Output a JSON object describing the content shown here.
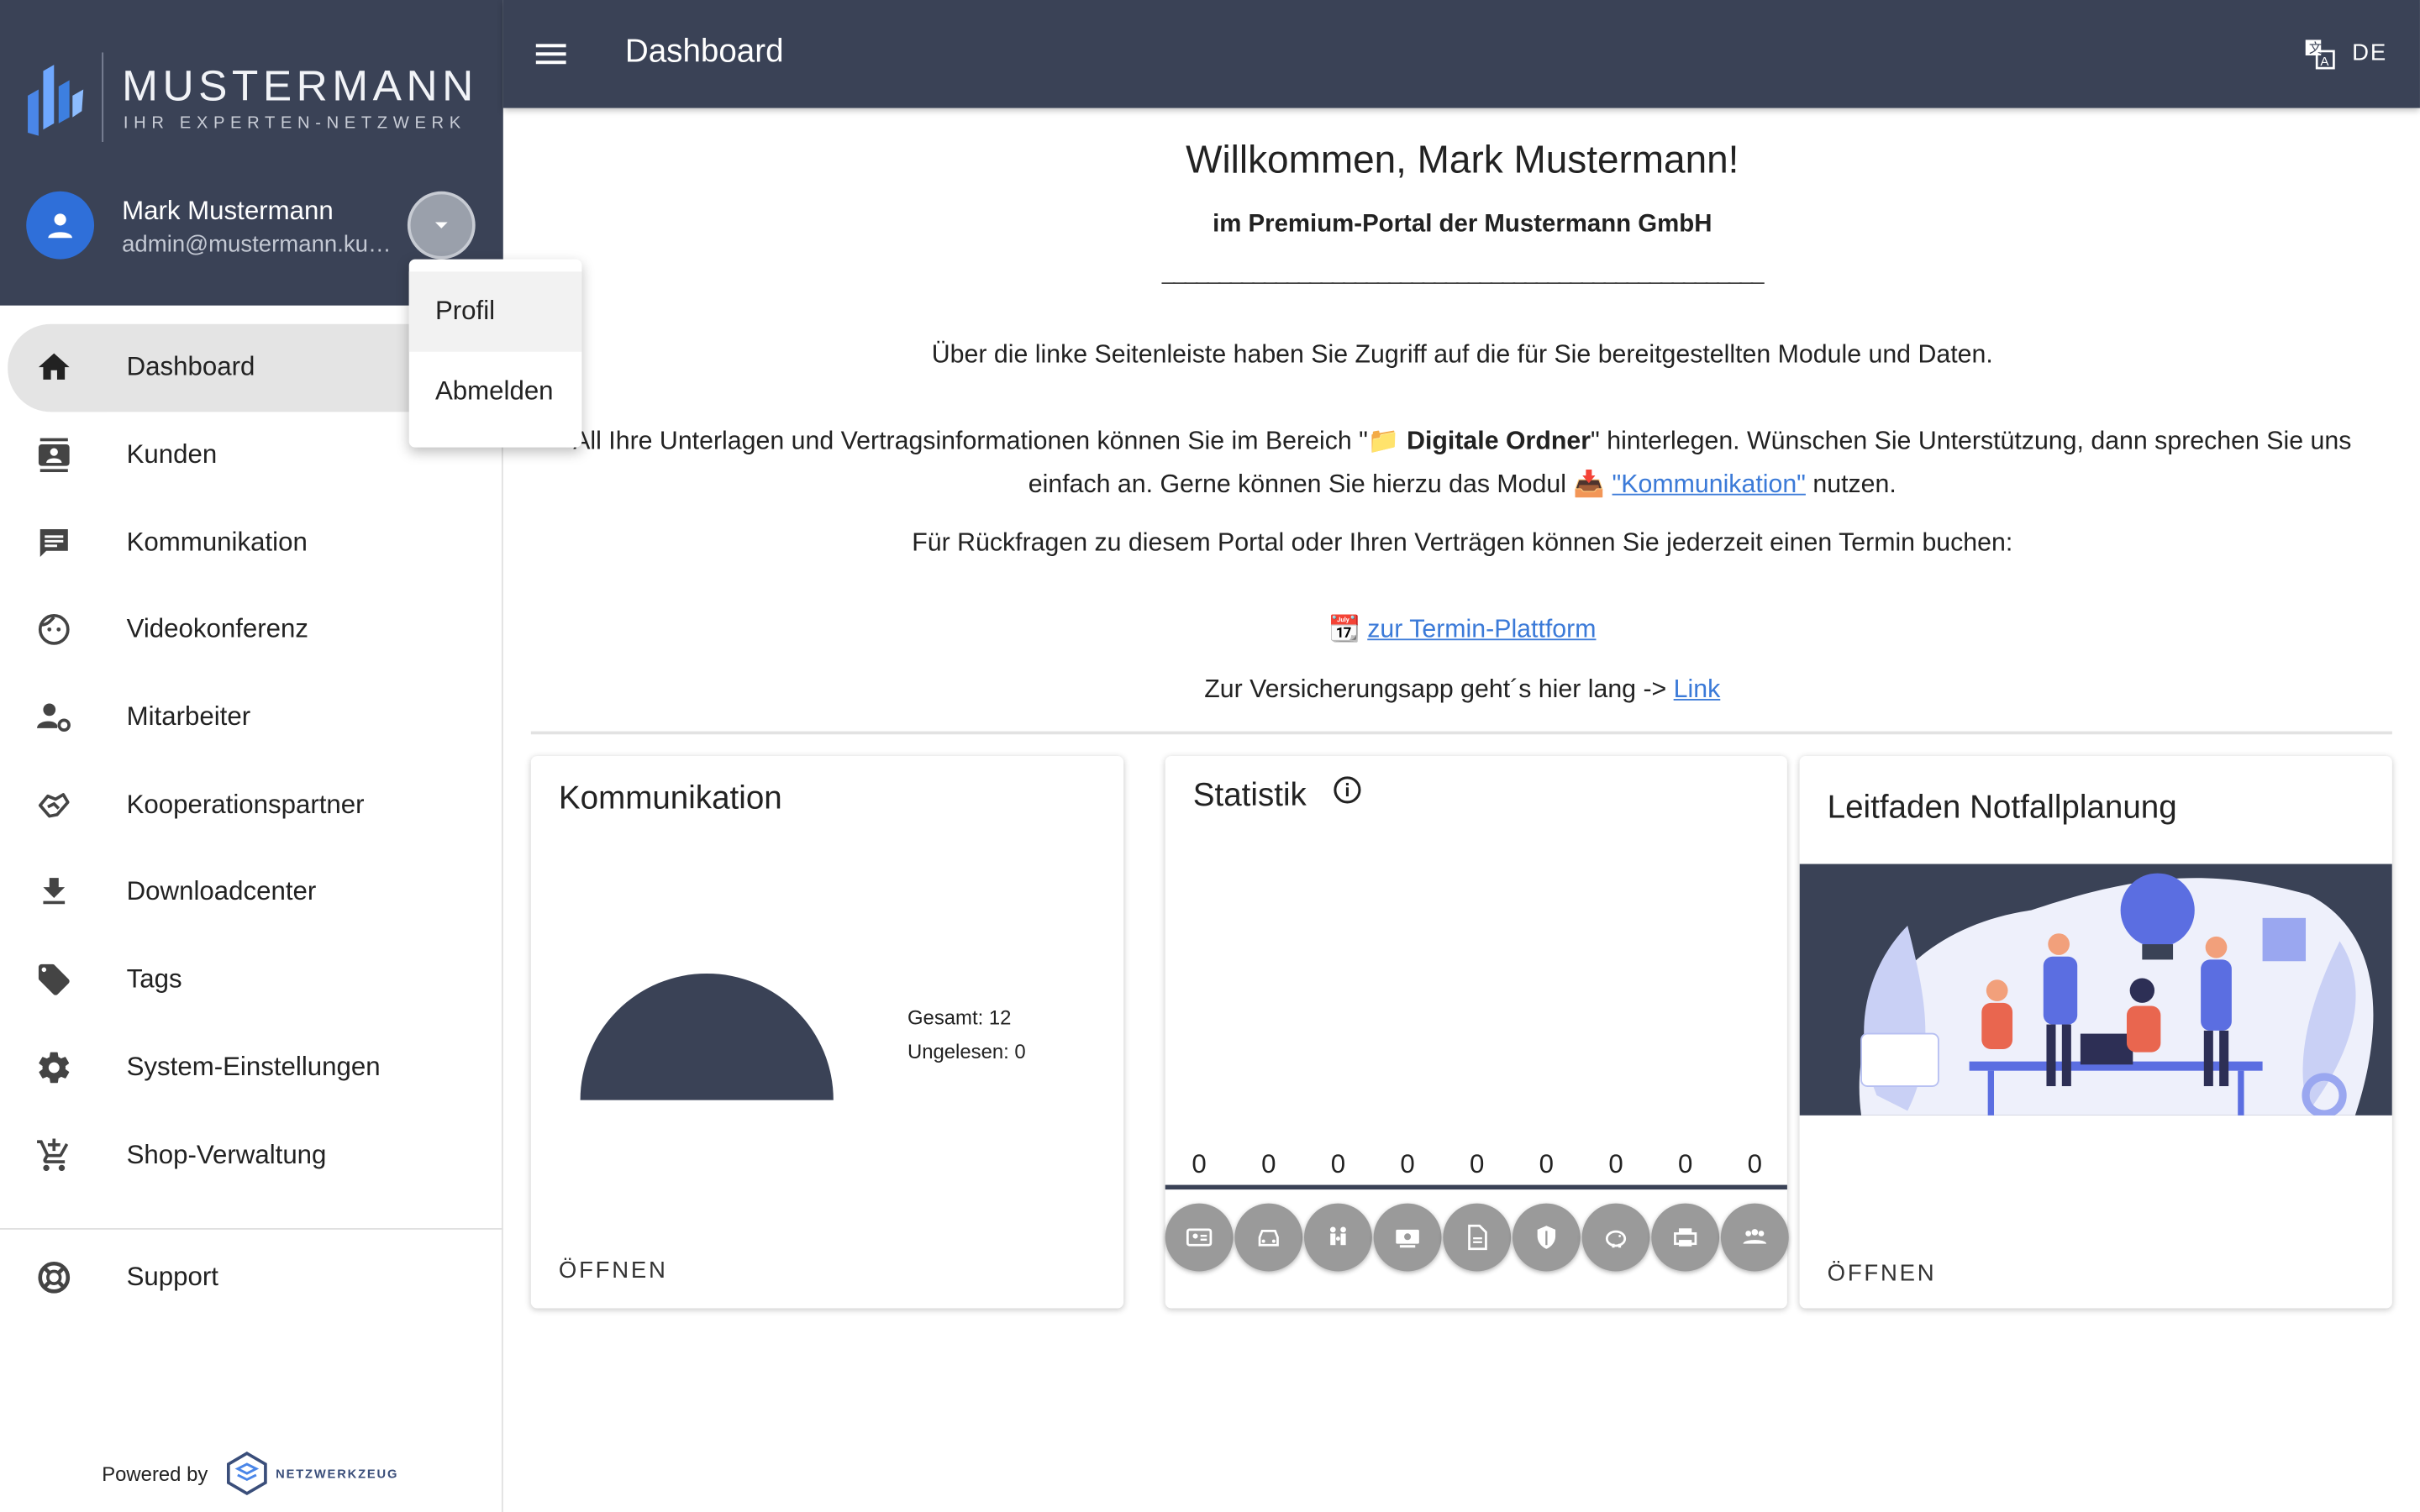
{
  "brand": {
    "name": "MUSTERMANN",
    "tagline": "IHR EXPERTEN-NETZWERK"
  },
  "user": {
    "name": "Mark Mustermann",
    "email": "admin@mustermann.kunde.de"
  },
  "user_menu": {
    "items": [
      "Profil",
      "Abmelden"
    ]
  },
  "sidebar": {
    "items": [
      {
        "label": "Dashboard",
        "icon": "home-icon",
        "active": true
      },
      {
        "label": "Kunden",
        "icon": "contact-card-icon"
      },
      {
        "label": "Kommunikation",
        "icon": "chat-icon"
      },
      {
        "label": "Videokonferenz",
        "icon": "face-icon"
      },
      {
        "label": "Mitarbeiter",
        "icon": "user-settings-icon"
      },
      {
        "label": "Kooperationspartner",
        "icon": "handshake-icon"
      },
      {
        "label": "Downloadcenter",
        "icon": "download-icon"
      },
      {
        "label": "Tags",
        "icon": "tag-icon"
      },
      {
        "label": "System-Einstellungen",
        "icon": "gear-icon"
      },
      {
        "label": "Shop-Verwaltung",
        "icon": "cart-add-icon"
      }
    ],
    "support": "Support",
    "powered_by": "Powered by",
    "powered_logo": "NETZWERKZEUG"
  },
  "topbar": {
    "title": "Dashboard",
    "language": "DE"
  },
  "content": {
    "welcome": "Willkommen, Mark Mustermann!",
    "subtitle": "im Premium-Portal der Mustermann GmbH",
    "rule": "_____________________________________________________",
    "p1": "Über die linke Seitenleiste haben Sie Zugriff auf die für Sie bereitgestellten Module und Daten.",
    "p2a": "All Ihre Unterlagen und Vertragsinformationen können Sie im Bereich \"",
    "p2b": "Digitale Ordner",
    "p2c": "\" hinterlegen. Wünschen Sie Unterstützung, dann sprechen Sie uns einfach an. Gerne können Sie hierzu das Modul ",
    "p2link": "\"Kommunikation\"",
    "p2d": " nutzen.",
    "p3": "Für Rückfragen zu diesem Portal oder Ihren Verträgen können Sie jederzeit einen Termin buchen:",
    "termin_link": "zur Termin-Plattform",
    "p4": "Zur Versicherungsapp geht´s hier lang -> ",
    "p4link": "Link"
  },
  "cards": {
    "kommunikation": {
      "title": "Kommunikation",
      "gesamt": "Gesamt: 12",
      "ungelesen": "Ungelesen: 0",
      "action": "ÖFFNEN",
      "total": 12,
      "unread": 0
    },
    "statistik": {
      "title": "Statistik",
      "values": [
        "0",
        "0",
        "0",
        "0",
        "0",
        "0",
        "0",
        "0",
        "0"
      ],
      "icons": [
        "person-card-icon",
        "car-icon",
        "family-icon",
        "money-icon",
        "document-icon",
        "shield-icon",
        "piggy-bank-icon",
        "printer-icon",
        "group-icon"
      ]
    },
    "notfall": {
      "title": "Leitfaden Notfallplanung",
      "action": "ÖFFNEN"
    }
  },
  "colors": {
    "header": "#3a4256",
    "accent": "#2f6fd9",
    "link": "#3b7ad8"
  }
}
